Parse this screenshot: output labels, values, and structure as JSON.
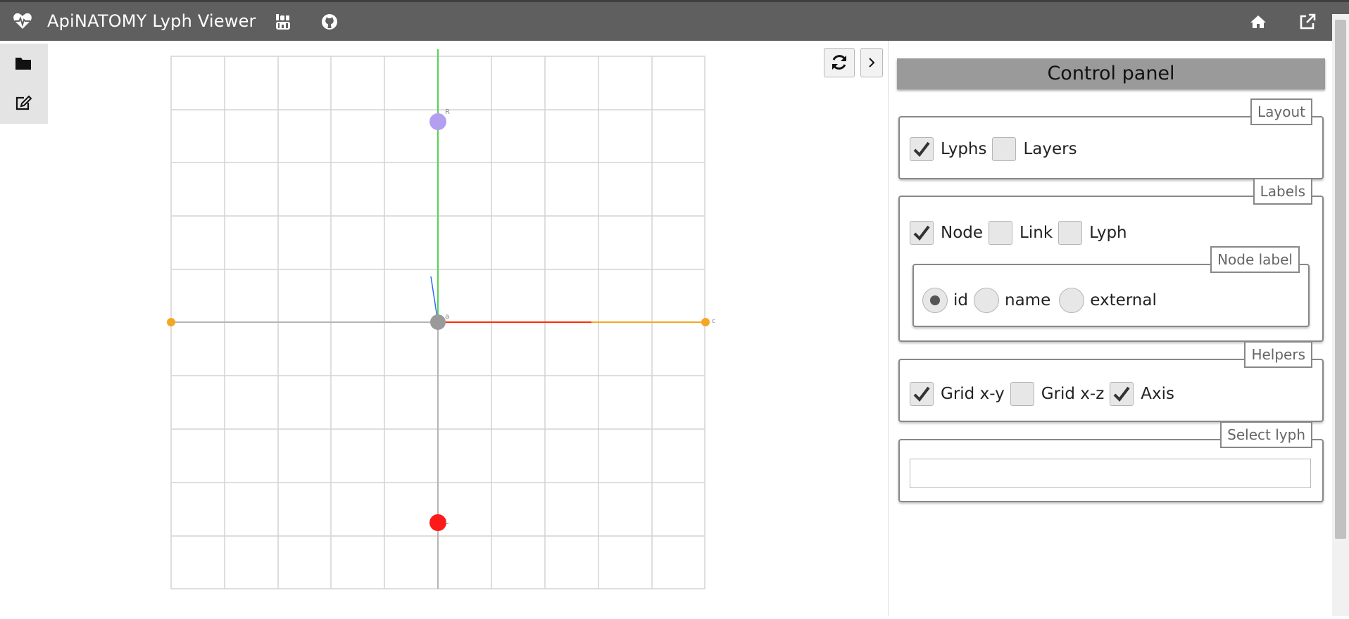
{
  "header": {
    "title": "ApiNATOMY Lyph Viewer",
    "icons": [
      "heartbeat-icon",
      "youtube-icon",
      "github-icon",
      "home-icon",
      "external-link-icon"
    ]
  },
  "sidebar": {
    "items": [
      {
        "icon": "folder-icon"
      },
      {
        "icon": "edit-icon"
      }
    ]
  },
  "viewer": {
    "node_labels": [
      "R",
      "a",
      "c",
      "L"
    ],
    "node_colors": {
      "R": "#b49ef0",
      "a": "#9a9a9a",
      "c": "#f5a623",
      "L": "#ff1a1a",
      "left_end": "#f5a623"
    },
    "axis_colors": {
      "x": "#ff0000",
      "y": "#33dd33",
      "z": "#3366ff"
    },
    "grid": "x-y"
  },
  "control_panel": {
    "title": "Control panel",
    "layout": {
      "legend": "Layout",
      "options": [
        {
          "label": "Lyphs",
          "checked": true
        },
        {
          "label": "Layers",
          "checked": false
        }
      ]
    },
    "labels": {
      "legend": "Labels",
      "options": [
        {
          "label": "Node",
          "checked": true
        },
        {
          "label": "Link",
          "checked": false
        },
        {
          "label": "Lyph",
          "checked": false
        }
      ],
      "node_label": {
        "legend": "Node label",
        "options": [
          {
            "label": "id",
            "selected": true
          },
          {
            "label": "name",
            "selected": false
          },
          {
            "label": "external",
            "selected": false
          }
        ]
      }
    },
    "helpers": {
      "legend": "Helpers",
      "options": [
        {
          "label": "Grid x-y",
          "checked": true
        },
        {
          "label": "Grid x-z",
          "checked": false
        },
        {
          "label": "Axis",
          "checked": true
        }
      ]
    },
    "select_lyph": {
      "legend": "Select lyph",
      "value": "",
      "placeholder": ""
    }
  }
}
